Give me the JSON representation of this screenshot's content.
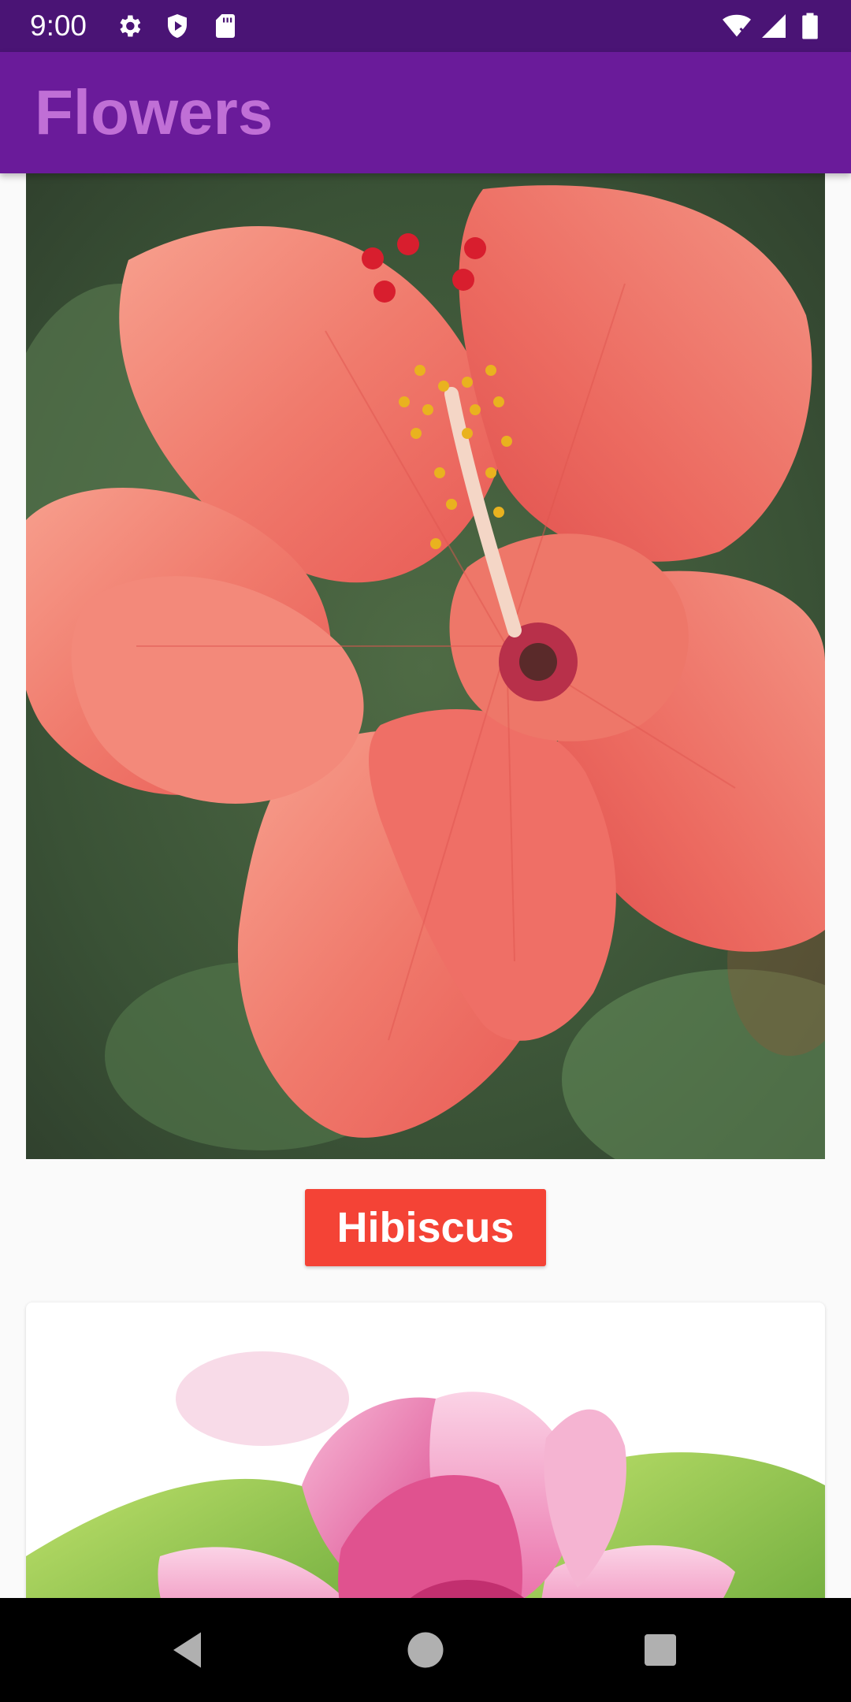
{
  "status_bar": {
    "time": "9:00",
    "icons": [
      "gear-icon",
      "shield-icon",
      "sd-card-icon",
      "wifi-icon",
      "signal-icon",
      "battery-icon"
    ]
  },
  "app_bar": {
    "title": "Flowers",
    "background_color": "#6a1b9a",
    "title_color": "#c06fd6"
  },
  "flowers": [
    {
      "name": "Hibiscus",
      "label_color": "#f44336"
    }
  ],
  "navigation": {
    "buttons": [
      "back-icon",
      "home-icon",
      "recents-icon"
    ]
  }
}
